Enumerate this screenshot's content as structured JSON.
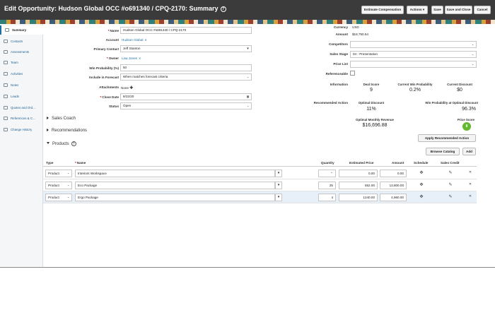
{
  "header": {
    "title": "Edit Opportunity: Hudson Global OCC #o691340 / CPQ-2170: Summary",
    "help_icon": "?",
    "buttons": {
      "estimate_compensation": "Estimate Compensation",
      "actions": "Actions",
      "save": "Save",
      "save_and_close": "Save and Close",
      "cancel": "Cancel"
    }
  },
  "sidebar": {
    "items": [
      {
        "label": "Summary",
        "icon": "summary-icon"
      },
      {
        "label": "Contacts",
        "icon": "contacts-icon"
      },
      {
        "label": "Assessments",
        "icon": "assessments-icon"
      },
      {
        "label": "Team",
        "icon": "team-icon"
      },
      {
        "label": "Activities",
        "icon": "activities-icon"
      },
      {
        "label": "Notes",
        "icon": "notes-icon"
      },
      {
        "label": "Leads",
        "icon": "leads-icon"
      },
      {
        "label": "Quotes and Ord...",
        "icon": "quotes-icon"
      },
      {
        "label": "References & C...",
        "icon": "references-icon"
      },
      {
        "label": "Change History",
        "icon": "history-icon"
      }
    ]
  },
  "form": {
    "name_label": "Name",
    "name_value": "Hudson Global OCC #o691340 / CPQ-2170",
    "account_label": "Account",
    "account_value": "Hudson Global",
    "primary_contact_label": "Primary Contact",
    "primary_contact_value": "Jeff Stanton",
    "owner_label": "Owner",
    "owner_value": "Lisa Jones",
    "win_prob_label": "Win Probability (%)",
    "win_prob_value": "50",
    "include_forecast_label": "Include in Forecast",
    "include_forecast_value": "When matches forecast criteria",
    "attachments_label": "Attachments",
    "attachments_value": "None",
    "close_date_label": "Close Date",
    "close_date_value": "8/22/20",
    "status_label": "Status",
    "status_value": "Open"
  },
  "right_form": {
    "currency_label": "Currency",
    "currency_value": "USD",
    "amount_label": "Amount",
    "amount_value": "$18,750.54",
    "competitors_label": "Competitors",
    "sales_stage_label": "Sales Stage",
    "sales_stage_value": "04 - Presentation",
    "price_list_label": "Price List",
    "referenceable_label": "Referenceable",
    "information_label": "Information",
    "recommendation_label": "Recommended Action"
  },
  "metrics": {
    "deal_score_label": "Deal Score",
    "deal_score_value": "9",
    "current_win_prob_label": "Current Win Probability",
    "current_win_prob_value": "0.2%",
    "current_discount_label": "Current Discount",
    "current_discount_value": "$0",
    "optimal_discount_label": "Optimal Discount",
    "optimal_discount_value": "11%",
    "win_prob_optimal_label": "Win Probability at Optimal Discount",
    "win_prob_optimal_value": "96.3%",
    "optimal_revenue_label": "Optimal Monthly Revenue",
    "optimal_revenue_value": "$16,696.88",
    "price_score_label": "Price Score",
    "price_score_value": "8",
    "apply_button": "Apply Recommended Action"
  },
  "sections": {
    "sales_coach": "Sales Coach",
    "recommendations": "Recommendations",
    "products": "Products"
  },
  "products": {
    "browse_catalog": "Browse Catalog",
    "add": "Add",
    "columns": {
      "type": "Type",
      "name": "Name",
      "quantity": "Quantity",
      "estimated_price": "Estimated Price",
      "amount": "Amount",
      "schedule": "Schedule",
      "sales_credit": "Sales Credit"
    },
    "rows": [
      {
        "type": "Product",
        "name": "Interiors Workspace",
        "quantity": "",
        "price": "0.00",
        "amount": "0.00"
      },
      {
        "type": "Product",
        "name": "Eco Package",
        "quantity": "25",
        "price": "552.00",
        "amount": "13,800.00"
      },
      {
        "type": "Product",
        "name": "Ergo Package",
        "quantity": "4",
        "price": "1240.00",
        "amount": "4,960.00"
      }
    ]
  },
  "colors": {
    "header_bg": "#3b3b3b",
    "link": "#1b6fa6",
    "price_score": "#63b830",
    "selected_row": "#e7f0f8"
  }
}
